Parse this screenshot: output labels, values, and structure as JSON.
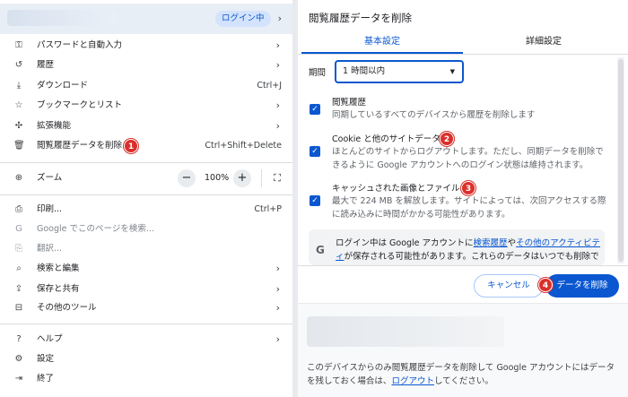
{
  "menu": {
    "profile": {
      "status": "ログイン中"
    },
    "items_top": [
      {
        "label": "パスワードと自動入力",
        "icon": "key-icon",
        "chev": true
      },
      {
        "label": "履歴",
        "icon": "history-icon",
        "chev": true
      },
      {
        "label": "ダウンロード",
        "icon": "download-icon",
        "shortcut": "Ctrl+J"
      },
      {
        "label": "ブックマークとリスト",
        "icon": "star-icon",
        "chev": true
      },
      {
        "label": "拡張機能",
        "icon": "puzzle-icon",
        "chev": true
      },
      {
        "label": "閲覧履歴データを削除...",
        "icon": "trash-icon",
        "shortcut": "Ctrl+Shift+Delete",
        "badge": "1"
      }
    ],
    "zoom": {
      "label": "ズーム",
      "minus": "−",
      "value": "100%",
      "plus": "+"
    },
    "items_mid": [
      {
        "label": "印刷...",
        "icon": "print-icon",
        "shortcut": "Ctrl+P"
      },
      {
        "label": "Google でこのページを検索...",
        "icon": "google-icon",
        "dim": true
      },
      {
        "label": "翻訳...",
        "icon": "translate-icon",
        "dim": true
      },
      {
        "label": "検索と編集",
        "icon": "search-edit-icon",
        "chev": true
      },
      {
        "label": "保存と共有",
        "icon": "save-share-icon",
        "chev": true
      },
      {
        "label": "その他のツール",
        "icon": "toolbox-icon",
        "chev": true
      }
    ],
    "items_bottom": [
      {
        "label": "ヘルプ",
        "icon": "help-icon",
        "chev": true
      },
      {
        "label": "設定",
        "icon": "settings-icon"
      },
      {
        "label": "終了",
        "icon": "exit-icon"
      }
    ]
  },
  "dialog": {
    "title": "閲覧履歴データを削除",
    "tabs": [
      "基本設定",
      "詳細設定"
    ],
    "period_label": "期間",
    "period_value": "1 時間以内",
    "options": [
      {
        "title": "閲覧履歴",
        "desc": "同期しているすべてのデバイスから履歴を削除します"
      },
      {
        "title": "Cookie と他のサイトデータ",
        "desc": "ほとんどのサイトからログアウトします。ただし、同期データを削除できるように Google アカウントへのログイン状態は維持されます。",
        "badge": "2"
      },
      {
        "title": "キャッシュされた画像とファイル",
        "desc": "最大で 224 MB を解放します。サイトによっては、次回アクセスする際に読み込みに時間がかかる可能性があります。",
        "badge": "3"
      }
    ],
    "info": {
      "before": "ログイン中は Google アカウントに",
      "link1": "検索履歴",
      "mid": "や",
      "link2": "その他のアクティビティ",
      "after": "が保存される可能性があります。これらのデータはいつでも削除で"
    },
    "cancel": "キャンセル",
    "delete": "データを削除",
    "delete_badge": "4",
    "footer": {
      "before": "このデバイスからのみ閲覧履歴データを削除して Google アカウントにはデータを残しておく場合は、",
      "link": "ログアウト",
      "after": "してください。"
    }
  },
  "colors": {
    "accent": "#0b57d0",
    "badge": "#d9302b"
  }
}
